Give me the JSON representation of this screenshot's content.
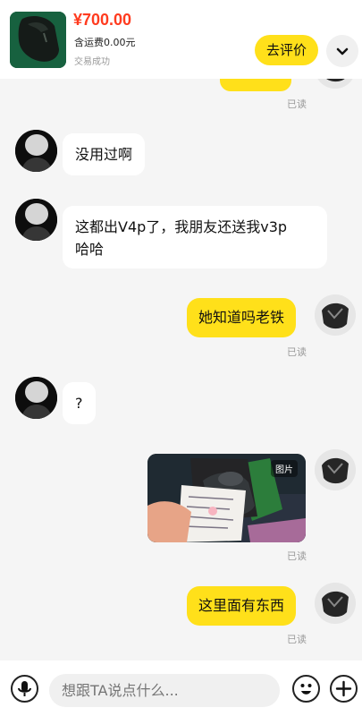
{
  "header": {
    "price": "¥700.00",
    "shipping": "含运费0.00元",
    "status": "交易成功",
    "review_button": "去评价",
    "collapse_icon": "chevron-down-icon"
  },
  "messages": [
    {
      "from": "me",
      "kind": "text",
      "read": "已读"
    },
    {
      "from": "other",
      "kind": "text",
      "text": "没用过啊"
    },
    {
      "from": "other",
      "kind": "text",
      "lines": [
        "这都出V4p了，我朋友还送我v3p",
        "哈哈"
      ]
    },
    {
      "from": "me",
      "kind": "text",
      "text": "她知道吗老铁",
      "read": "已读"
    },
    {
      "from": "other",
      "kind": "text",
      "text": "?"
    },
    {
      "from": "me",
      "kind": "image",
      "tag": "图片",
      "read": "已读"
    },
    {
      "from": "me",
      "kind": "text",
      "text": "这里面有东西",
      "read": "已读"
    }
  ],
  "input": {
    "placeholder": "想跟TA说点什么..."
  },
  "icons": {
    "voice": "microphone-icon",
    "emoji": "emoji-icon",
    "plus": "plus-icon"
  },
  "colors": {
    "accent": "#ffe01a",
    "price": "#ff3b1f",
    "background": "#f5f5f5"
  }
}
